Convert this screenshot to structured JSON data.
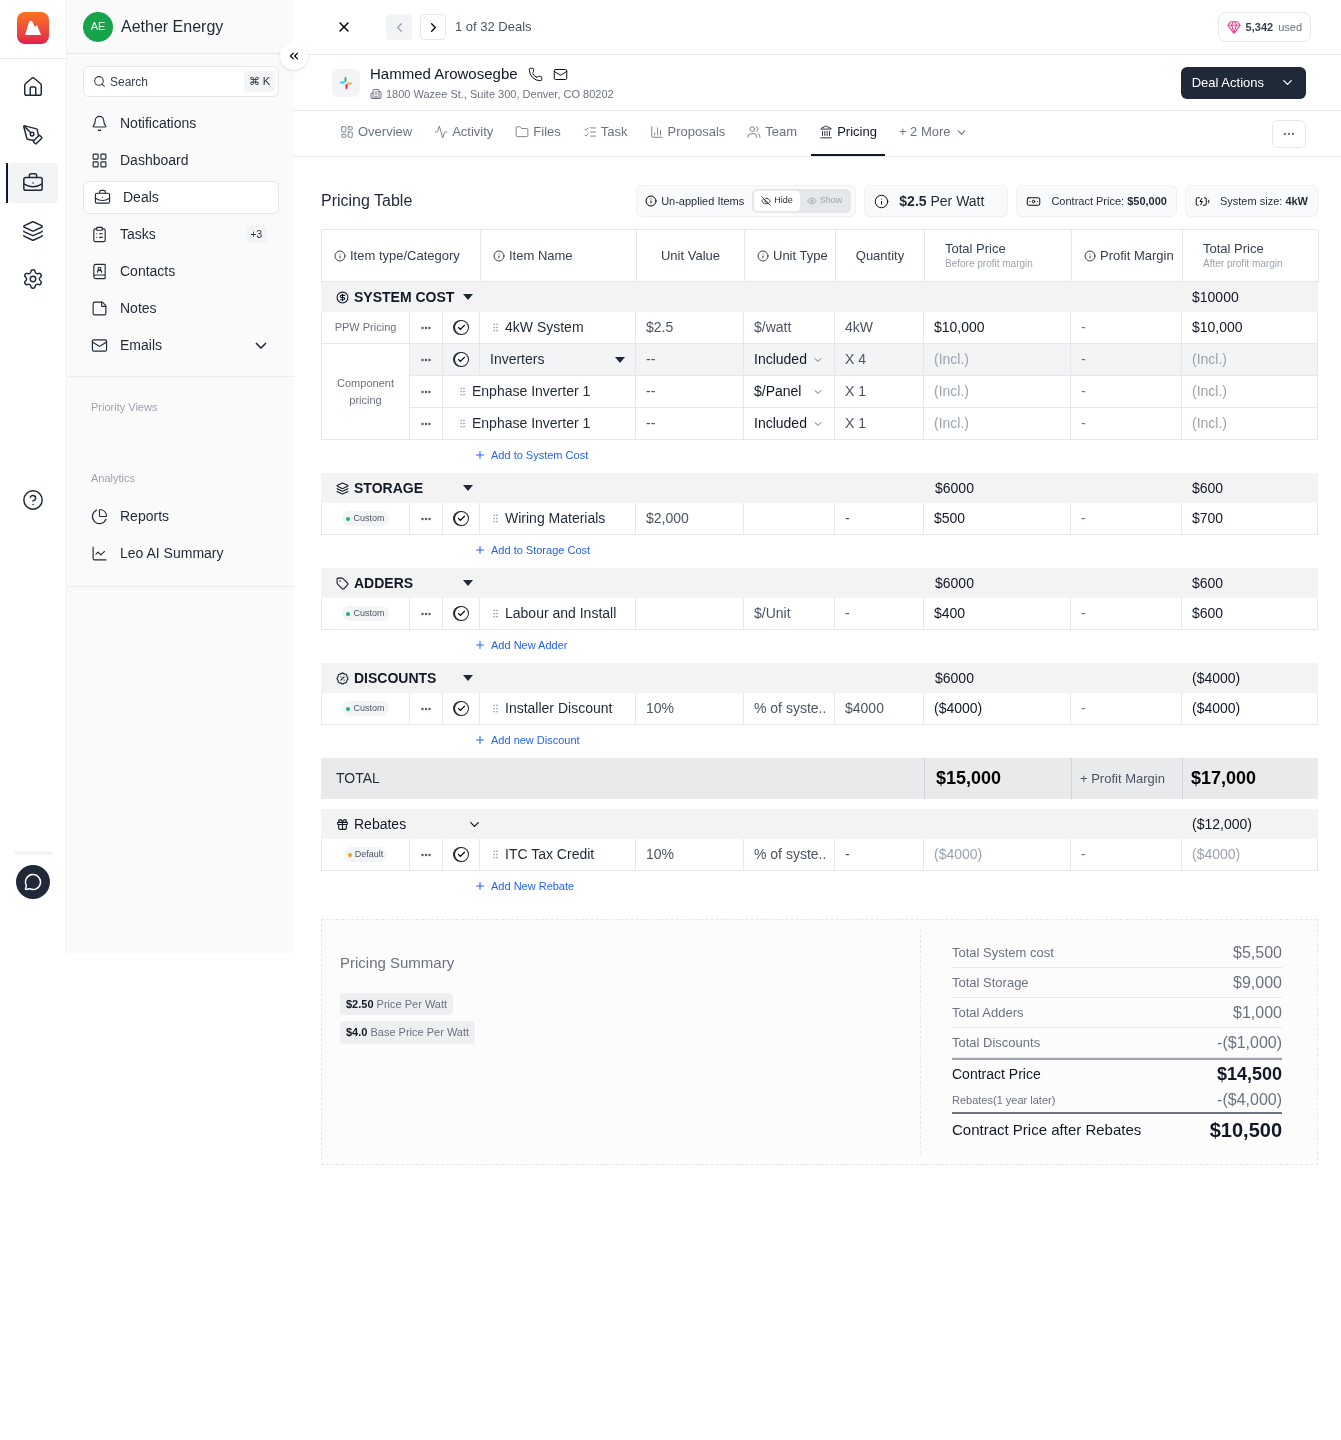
{
  "rail": {
    "items": [
      {
        "selected": false
      },
      {
        "selected": false
      },
      {
        "selected": true
      },
      {
        "selected": false
      },
      {
        "selected": false
      }
    ]
  },
  "sidebar": {
    "org": {
      "initials": "AE",
      "name": "Aether Energy"
    },
    "search": {
      "placeholder": "Search",
      "shortcut": "⌘ K"
    },
    "items": [
      {
        "label": "Notifications",
        "selected": false
      },
      {
        "label": "Dashboard",
        "selected": false
      },
      {
        "label": "Deals",
        "selected": true
      },
      {
        "label": "Tasks",
        "selected": false,
        "badge": "+3"
      },
      {
        "label": "Contacts",
        "selected": false
      },
      {
        "label": "Notes",
        "selected": false
      },
      {
        "label": "Emails",
        "selected": false,
        "expanded": false
      }
    ],
    "sections": [
      {
        "title": "Priority Views"
      },
      {
        "title": "Analytics",
        "items": [
          {
            "label": "Reports",
            "selected": false
          },
          {
            "label": "Leo AI Summary",
            "selected": false
          }
        ]
      }
    ]
  },
  "topbar": {
    "prev_disabled": true,
    "counter": "1 of 32 Deals",
    "credits": {
      "value": "5,342",
      "label": "used"
    }
  },
  "contact": {
    "name": "Hammed Arowosegbe",
    "address": "1800 Wazee St., Suite 300, Denver, CO 80202",
    "action": "Deal Actions"
  },
  "tabs": [
    {
      "label": "Overview",
      "selected": false
    },
    {
      "label": "Activity",
      "selected": false
    },
    {
      "label": "Files",
      "selected": false
    },
    {
      "label": "Task",
      "selected": false
    },
    {
      "label": "Proposals",
      "selected": false
    },
    {
      "label": "Team",
      "selected": false
    },
    {
      "label": "Pricing",
      "selected": true
    },
    {
      "label": "+ 2 More",
      "selected": false
    }
  ],
  "pricing": {
    "title": "Pricing Table",
    "unapplied": {
      "label": "Un-applied Items",
      "options": [
        {
          "label": "Hide",
          "selected": true
        },
        {
          "label": "Show",
          "selected": false
        }
      ]
    },
    "stats": [
      "**$2.5** Per Watt",
      "Contract Price: **$50,000**",
      "System size: **4kW**"
    ],
    "columns": [
      {
        "label": "Item type/Category",
        "info": true
      },
      {
        "label": "Item Name",
        "info": true
      },
      {
        "label": "Unit Value",
        "info": false
      },
      {
        "label": "Unit Type",
        "info": true
      },
      {
        "label": "Quantity",
        "info": false
      },
      {
        "label": "Total Price",
        "sub": "Before profit margin",
        "info": false
      },
      {
        "label": "Profit Margin",
        "info": true
      },
      {
        "label": "Total Price",
        "sub": "After profit margin",
        "info": false
      }
    ],
    "sections": [
      {
        "name": "SYSTEM COST",
        "emphasis": true,
        "total_after": "$10000",
        "add_label": "Add to System Cost",
        "rows": [
          {
            "kind": "item",
            "tag": {
              "kind": "label",
              "text": "PPW Pricing"
            },
            "on": true,
            "name": "4kW System",
            "unit_value": "$2.5",
            "unit_type": "$/watt",
            "dropdown": false,
            "quantity": "4kW",
            "total": "$10,000",
            "margin": "-",
            "total_after": "$10,000",
            "muted": false
          },
          {
            "kind": "group",
            "on": true,
            "name": "Inverters",
            "unit_value": "--",
            "unit_type": "Included",
            "dropdown": true,
            "quantity": "X 4",
            "total": "(Incl.)",
            "margin": "-",
            "total_after": "(Incl.)",
            "muted": true,
            "tag": {
              "kind": "label",
              "text": "Component pricing"
            }
          },
          {
            "kind": "subitem",
            "name": "Enphase Inverter 1",
            "unit_value": "--",
            "unit_type": "$/Panel",
            "dropdown": true,
            "quantity": "X 1",
            "total": "(Incl.)",
            "margin": "-",
            "total_after": "(Incl.)",
            "muted": true
          },
          {
            "kind": "subitem",
            "name": "Enphase Inverter 1",
            "unit_value": "--",
            "unit_type": "Included",
            "dropdown": true,
            "quantity": "X 1",
            "total": "(Incl.)",
            "margin": "-",
            "total_after": "(Incl.)",
            "muted": true
          }
        ]
      },
      {
        "name": "STORAGE",
        "emphasis": true,
        "total": "$6000",
        "total_after": "$600",
        "add_label": "Add to Storage Cost",
        "rows": [
          {
            "kind": "item",
            "tag": {
              "kind": "badge",
              "text": "Custom",
              "color": "#10b981"
            },
            "on": true,
            "name": "Wiring Materials",
            "unit_value": "$2,000",
            "quantity": "-",
            "dropdown": false,
            "total": "$500",
            "margin": "-",
            "total_after": "$700",
            "muted": false
          }
        ]
      },
      {
        "name": "ADDERS",
        "emphasis": true,
        "total": "$6000",
        "total_after": "$600",
        "add_label": "Add New Adder",
        "rows": [
          {
            "kind": "item",
            "tag": {
              "kind": "badge",
              "text": "Custom",
              "color": "#10b981"
            },
            "on": true,
            "name": "Labour and Install",
            "unit_type": "$/Unit",
            "dropdown": false,
            "quantity": "-",
            "total": "$400",
            "margin": "-",
            "total_after": "$600",
            "muted": false
          }
        ]
      },
      {
        "name": "DISCOUNTS",
        "emphasis": true,
        "total": "$6000",
        "total_after": "($4000)",
        "add_label": "Add new Discount",
        "rows": [
          {
            "kind": "item",
            "tag": {
              "kind": "badge",
              "text": "Custom",
              "color": "#10b981"
            },
            "on": true,
            "name": "Installer Discount",
            "unit_value": "10%",
            "unit_type": "% of syste..",
            "dropdown": false,
            "quantity": "$4000",
            "total": "($4000)",
            "margin": "-",
            "total_after": "($4000)",
            "muted": false
          }
        ]
      }
    ],
    "total": {
      "label": "TOTAL",
      "total": "$15,000",
      "margin": "+ Profit Margin",
      "total_after": "$17,000"
    },
    "rebates": {
      "name": "Rebates",
      "emphasis": false,
      "total_after": "($12,000)",
      "add_label": "Add New Rebate",
      "rows": [
        {
          "kind": "item",
          "tag": {
            "kind": "badge",
            "text": "Default",
            "color": "#f59e0b"
          },
          "on": true,
          "name": "ITC Tax Credit",
          "unit_value": "10%",
          "unit_type": "% of syste..",
          "dropdown": false,
          "quantity": "-",
          "total": "($4000)",
          "margin": "-",
          "total_after": "($4000)",
          "muted": true
        }
      ]
    }
  },
  "summary": {
    "title": "Pricing Summary",
    "chips": [
      "**$2.50** Price Per Watt",
      "**$4.0** Base Price Per Watt"
    ],
    "lines": [
      {
        "kind": "normal",
        "label": "Total System cost",
        "value": "$5,500"
      },
      {
        "kind": "normal",
        "label": "Total Storage",
        "value": "$9,000"
      },
      {
        "kind": "normal",
        "label": "Total Adders",
        "value": "$1,000"
      },
      {
        "kind": "normal",
        "label": "Total Discounts",
        "value": "-($1,000)"
      },
      {
        "kind": "strong",
        "label": "Contract Price",
        "value": "$14,500"
      },
      {
        "kind": "small",
        "label": "Rebates(1 year later)",
        "value": "-($4,000)"
      },
      {
        "kind": "grand",
        "label": "Contract Price after Rebates",
        "value": "$10,500"
      }
    ]
  }
}
